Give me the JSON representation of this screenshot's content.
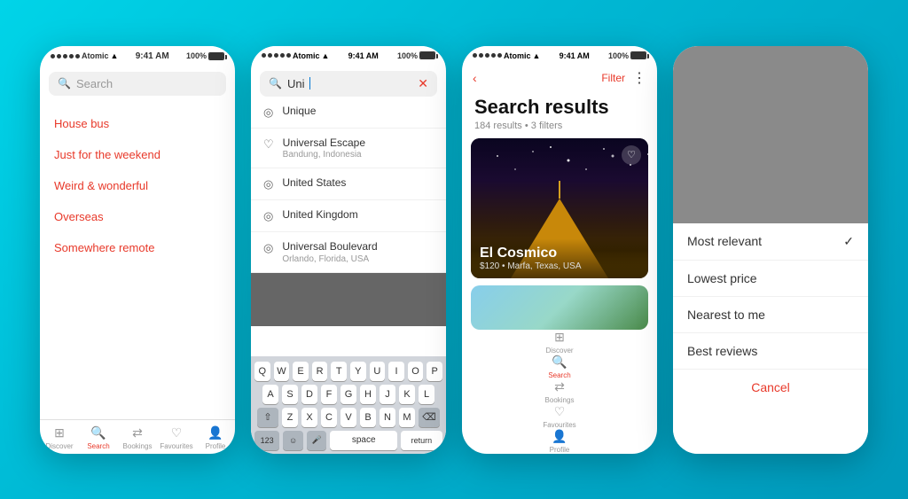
{
  "background": "#00c8d8",
  "screens": {
    "screen1": {
      "status": {
        "carrier": "Atomic",
        "wifi": true,
        "time": "9:41 AM",
        "battery": "100%"
      },
      "search": {
        "placeholder": "Search"
      },
      "menu": [
        {
          "id": "house-bus",
          "label": "House bus"
        },
        {
          "id": "just-weekend",
          "label": "Just for the weekend"
        },
        {
          "id": "weird-wonderful",
          "label": "Weird & wonderful"
        },
        {
          "id": "overseas",
          "label": "Overseas"
        },
        {
          "id": "somewhere-remote",
          "label": "Somewhere remote"
        }
      ],
      "tabs": [
        {
          "id": "discover",
          "label": "Discover",
          "icon": "⊞"
        },
        {
          "id": "search",
          "label": "Search",
          "icon": "🔍",
          "active": true
        },
        {
          "id": "bookings",
          "label": "Bookings",
          "icon": "⇄"
        },
        {
          "id": "favourites",
          "label": "Favourites",
          "icon": "♡"
        },
        {
          "id": "profile",
          "label": "Profile",
          "icon": "👤"
        }
      ]
    },
    "screen2": {
      "status": {
        "carrier": "Atomic",
        "wifi": true,
        "time": "9:41 AM",
        "battery": "100%"
      },
      "search": {
        "value": "Uni",
        "placeholder": ""
      },
      "suggestions": [
        {
          "id": "unique",
          "icon": "⊙",
          "text": "Unique",
          "subtext": ""
        },
        {
          "id": "universal-escape",
          "icon": "♡",
          "text": "Universal Escape",
          "subtext": "Bandung, Indonesia"
        },
        {
          "id": "united-states",
          "icon": "⊙",
          "text": "United States",
          "subtext": ""
        },
        {
          "id": "united-kingdom",
          "icon": "⊙",
          "text": "United Kingdom",
          "subtext": ""
        },
        {
          "id": "universal-boulevard",
          "icon": "⊙",
          "text": "Universal Boulevard",
          "subtext": "Orlando, Florida, USA"
        }
      ],
      "keyboard": {
        "rows": [
          [
            "Q",
            "W",
            "E",
            "R",
            "T",
            "Y",
            "U",
            "I",
            "O",
            "P"
          ],
          [
            "A",
            "S",
            "D",
            "F",
            "G",
            "H",
            "J",
            "K",
            "L"
          ],
          [
            "⇧",
            "Z",
            "X",
            "C",
            "V",
            "B",
            "N",
            "M",
            "⌫"
          ]
        ],
        "bottom": [
          "123",
          "☺",
          "🎤",
          "space",
          "return"
        ]
      }
    },
    "screen3": {
      "status": {
        "carrier": "Atomic",
        "wifi": true,
        "time": "9:41 AM",
        "battery": "100%"
      },
      "nav": {
        "back": "<",
        "filter": "Filter",
        "more": "⋮"
      },
      "title": "Search results",
      "results_count": "184 results • 3 filters",
      "card": {
        "name": "El Cosmico",
        "price": "$120",
        "location": "Marfa, Texas, USA"
      },
      "tabs": [
        {
          "id": "discover",
          "label": "Discover",
          "icon": "⊞"
        },
        {
          "id": "search",
          "label": "Search",
          "icon": "🔍",
          "active": true
        },
        {
          "id": "bookings",
          "label": "Bookings",
          "icon": "⇄"
        },
        {
          "id": "favourites",
          "label": "Favourites",
          "icon": "♡"
        },
        {
          "id": "profile",
          "label": "Profile",
          "icon": "👤"
        }
      ]
    },
    "screen4": {
      "sort_options": [
        {
          "id": "most-relevant",
          "label": "Most relevant",
          "selected": true
        },
        {
          "id": "lowest-price",
          "label": "Lowest price",
          "selected": false
        },
        {
          "id": "nearest-me",
          "label": "Nearest to me",
          "selected": false
        },
        {
          "id": "best-reviews",
          "label": "Best reviews",
          "selected": false
        }
      ],
      "cancel_label": "Cancel"
    }
  }
}
